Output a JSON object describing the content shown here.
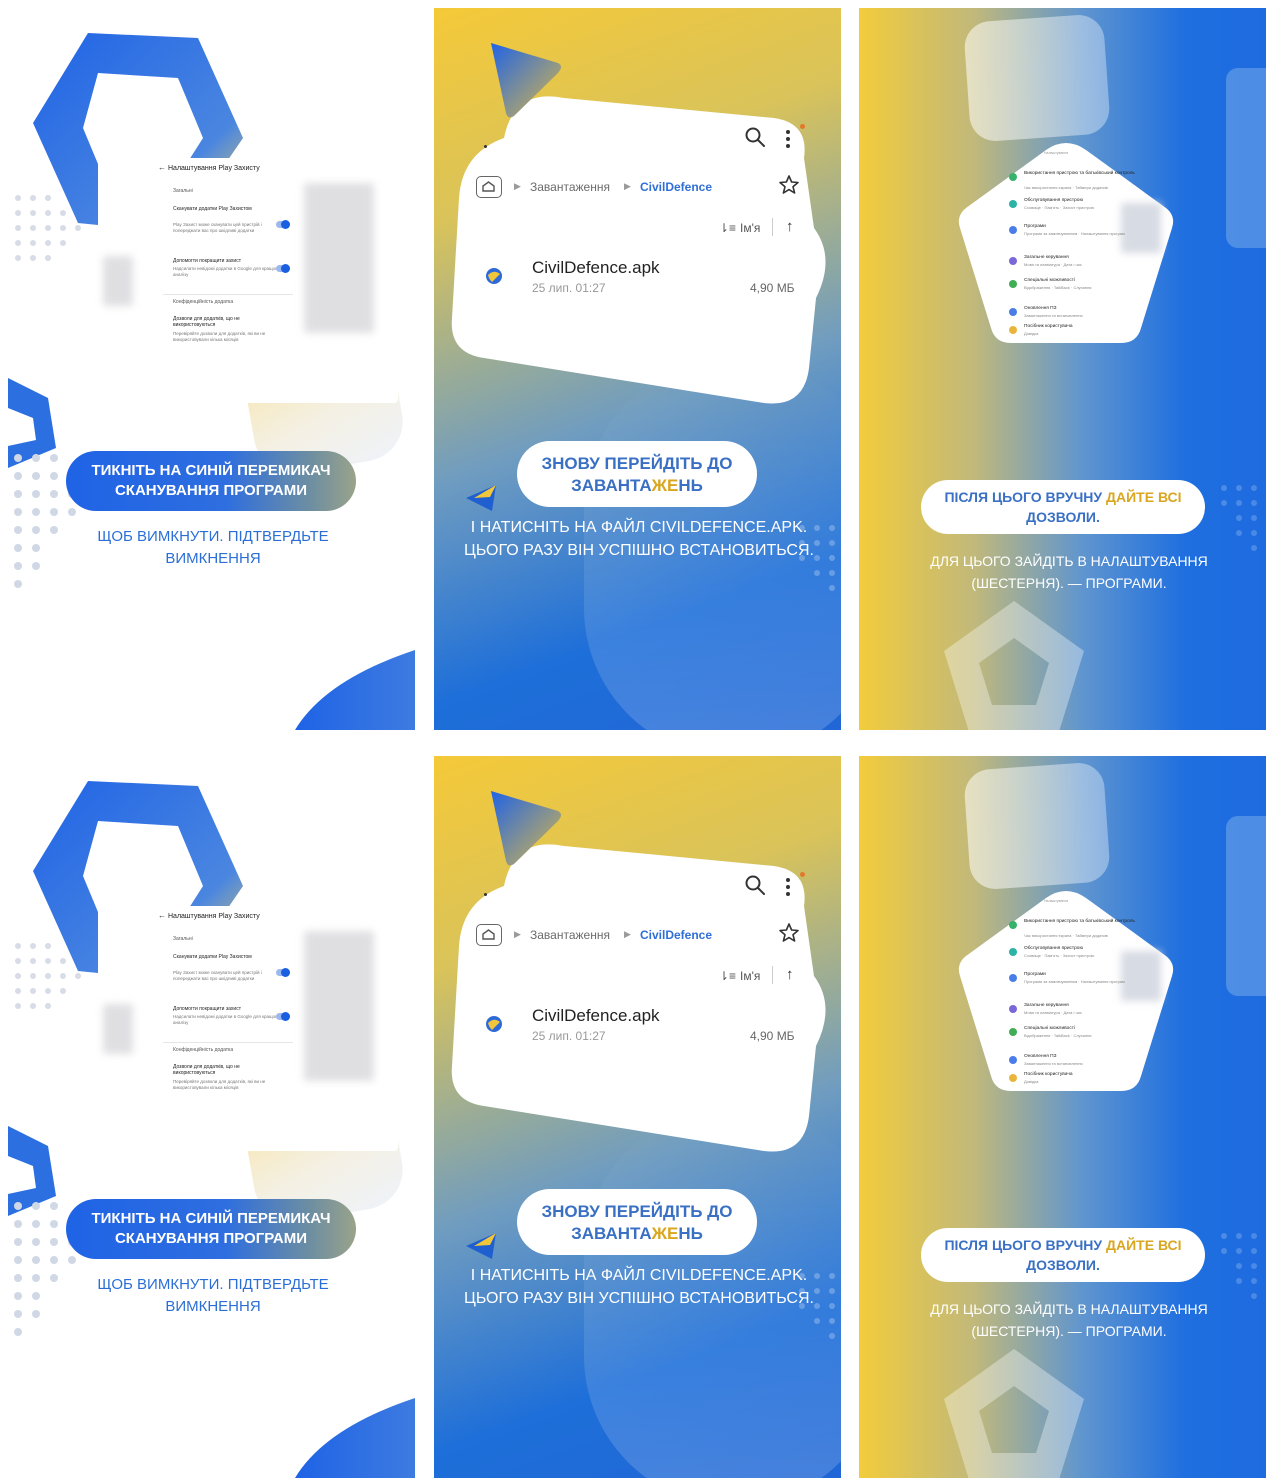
{
  "panels": {
    "play_protect": {
      "settings_title": "Налаштування Play Захисту",
      "section_general": "Загальні",
      "option_scan_title": "Сканувати додатки Play Захистом",
      "option_scan_desc": "Play Захист може сканувати цей пристрій і попереджати вас про шкідливі додатки",
      "option_improve_title": "Допомогти покращити захист",
      "option_improve_desc": "Надсилати невідомі додатки в Google для кращого аналізу",
      "section_privacy": "Конфіденційність додатка",
      "option_perm_title": "Дозволи для додатків, що не використовуються",
      "option_perm_desc": "Перевіряйте дозволи для додатків, які ви не використовували кілька місяців",
      "instruction_pill": "ТИКНІТЬ НА СИНІЙ ПЕРЕМИКАЧ СКАНУВАННЯ ПРОГРАМИ",
      "instruction_sub": "ЩОБ ВИМКНУТИ. ПІДТВЕРДЬТЕ ВИМКНЕННЯ"
    },
    "downloads": {
      "breadcrumb_downloads": "Завантаження",
      "breadcrumb_folder": "CivilDefence",
      "sort_label": "Ім'я",
      "file_name": "CivilDefence.apk",
      "file_date": "25 лип. 01:27",
      "file_size": "4,90 МБ",
      "pill_part1": "ЗНОВУ ПЕРЕЙДІТЬ ДО ЗАВАНТА",
      "pill_accent": "ЖЕ",
      "pill_part2": "НЬ",
      "instruction_sub": "І НАТИСНІТЬ НА ФАЙЛ CIVILDEFENCE.APK. ЦЬОГО РАЗУ ВІН УСПІШНО ВСТАНОВИТЬСЯ."
    },
    "settings": {
      "list_header": "Налаштування",
      "items": [
        {
          "title": "Використання пристрою та батьківський контроль",
          "desc": "Час використання екрана · Таймери додатків",
          "color": "#36b36a"
        },
        {
          "title": "Обслуговування пристрою",
          "desc": "Сховище · Пам'ять · Захист пристрою",
          "color": "#2bb3a6"
        },
        {
          "title": "Програми",
          "desc": "Програми за замовчуванням · Налаштування програм",
          "color": "#4a7de8"
        },
        {
          "title": "Загальне керування",
          "desc": "Мова та клавіатура · Дата і час",
          "color": "#7b68d8"
        },
        {
          "title": "Спеціальні можливості",
          "desc": "Відображення · TalkBack · Слухання",
          "color": "#3fae55"
        },
        {
          "title": "Оновлення ПЗ",
          "desc": "Завантаження та встановлення",
          "color": "#4a7de8"
        },
        {
          "title": "Посібник користувача",
          "desc": "Довідка",
          "color": "#e8b63a"
        }
      ],
      "pill_part1": "ПІСЛЯ ЦЬОГО ВРУЧНУ ",
      "pill_accent": "ДАЙТЕ ВСІ",
      "pill_part2": "ДОЗВОЛИ.",
      "instruction_sub": "ДЛЯ ЦЬОГО ЗАЙДІТЬ В НАЛАШТУВАННЯ (ШЕСТЕРНЯ). — ПРОГРАМИ."
    }
  },
  "colors": {
    "brand_blue": "#1f63e6",
    "brand_yellow": "#f5c938",
    "accent_text_blue": "#2b6fd6"
  }
}
